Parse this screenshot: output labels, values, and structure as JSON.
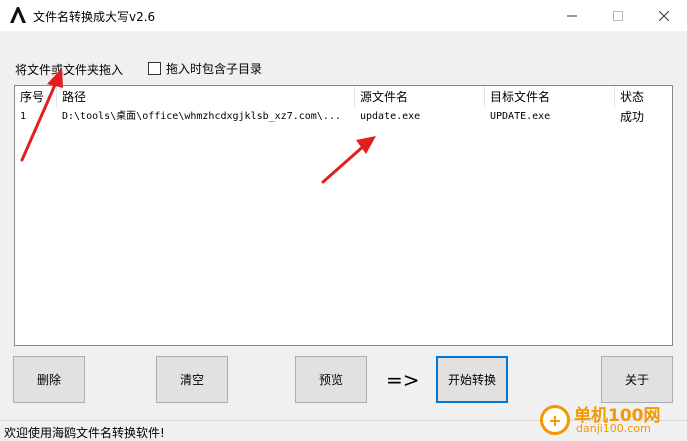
{
  "window": {
    "title": "文件名转换成大写v2.6",
    "app_icon_glyph": "A",
    "min_glyph": "—",
    "max_glyph": "☐",
    "close_glyph": "✕"
  },
  "drop_label": "将文件或文件夹拖入",
  "include_subdirs": {
    "label": "拖入时包含子目录",
    "checked": false
  },
  "table": {
    "columns": [
      "序号",
      "路径",
      "源文件名",
      "目标文件名",
      "状态"
    ],
    "rows": [
      {
        "index": "1",
        "path": "D:\\tools\\桌面\\office\\whmzhcdxgjklsb_xz7.com\\...",
        "source": "update.exe",
        "target": "UPDATE.exe",
        "status": "成功"
      }
    ]
  },
  "buttons": {
    "delete": "删除",
    "clear": "清空",
    "preview": "预览",
    "arrow": "=>",
    "start": "开始转换",
    "close": "关于"
  },
  "status_bar": "欢迎使用海鸥文件名转换软件!",
  "watermark": {
    "main": "单机100网",
    "sub": "danji100.com",
    "circle_glyph": "+"
  },
  "colors": {
    "accent_blue": "#0078d7",
    "annotation_red": "#e02020",
    "watermark_orange": "#f39800"
  }
}
